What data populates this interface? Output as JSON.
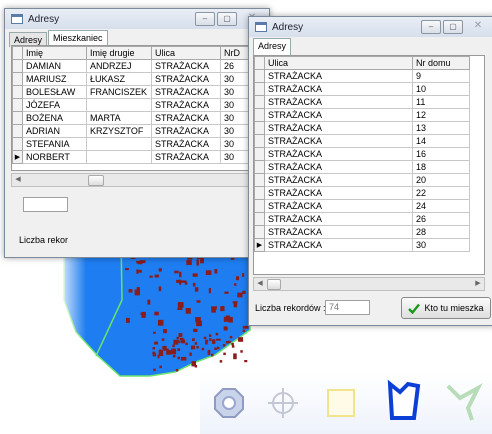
{
  "win1": {
    "title": "Adresy",
    "tabs": [
      "Adresy",
      "Mieszkaniec"
    ],
    "columns": [
      "Imię",
      "Imię drugie",
      "Ulica",
      "NrD"
    ],
    "rows": [
      [
        "DAMIAN",
        "ANDRZEJ",
        "STRAŻACKA",
        "26"
      ],
      [
        "MARIUSZ",
        "ŁUKASZ",
        "STRAŻACKA",
        "30"
      ],
      [
        "BOLESŁAW",
        "FRANCISZEK",
        "STRAŻACKA",
        "30"
      ],
      [
        "JÓZEFA",
        "",
        "STRAŻACKA",
        "30"
      ],
      [
        "BOŻENA",
        "MARTA",
        "STRAŻACKA",
        "30"
      ],
      [
        "ADRIAN",
        "KRZYSZTOF",
        "STRAŻACKA",
        "30"
      ],
      [
        "STEFANIA",
        "",
        "STRAŻACKA",
        "30"
      ],
      [
        "NORBERT",
        "",
        "STRAŻACKA",
        "30"
      ]
    ],
    "current_row_index": 7,
    "status_label": "Liczba rekor"
  },
  "win2": {
    "title": "Adresy",
    "tabs": [
      "Adresy"
    ],
    "columns": [
      "Ulica",
      "Nr domu"
    ],
    "rows": [
      [
        "STRAŻACKA",
        "9"
      ],
      [
        "STRAŻACKA",
        "10"
      ],
      [
        "STRAŻACKA",
        "11"
      ],
      [
        "STRAŻACKA",
        "12"
      ],
      [
        "STRAŻACKA",
        "13"
      ],
      [
        "STRAŻACKA",
        "14"
      ],
      [
        "STRAŻACKA",
        "16"
      ],
      [
        "STRAŻACKA",
        "18"
      ],
      [
        "STRAŻACKA",
        "20"
      ],
      [
        "STRAŻACKA",
        "22"
      ],
      [
        "STRAŻACKA",
        "24"
      ],
      [
        "STRAŻACKA",
        "26"
      ],
      [
        "STRAŻACKA",
        "28"
      ],
      [
        "STRAŻACKA",
        "30"
      ]
    ],
    "current_row_index": 13,
    "records_label": "Liczba rekordów :",
    "records_value": "74",
    "who_lives_button": "Kto tu mieszka"
  },
  "icons": {
    "window": "window-icon",
    "current_row": "row-pointer-icon",
    "who_lives": "checkmark-icon",
    "tools": [
      "octagon-tool-icon",
      "crosshair-tool-icon",
      "rectangle-tool-icon",
      "polygon-tool-icon",
      "polyline-tool-icon"
    ]
  },
  "colors": {
    "map_fill": "#1e7df0",
    "map_outline": "#69e36a",
    "buildings": "#8a1c1c",
    "checkmark": "#1a9a1a",
    "polygon_tool": "#0c3fd6"
  }
}
